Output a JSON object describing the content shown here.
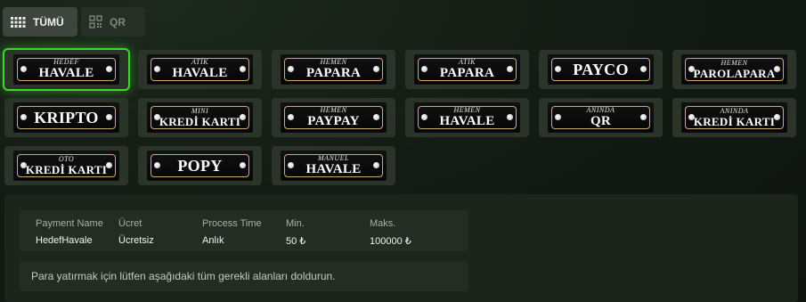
{
  "tabs": [
    {
      "label": "TÜMÜ",
      "icon": "grid-icon",
      "active": true
    },
    {
      "label": "QR",
      "icon": "qr-code-icon",
      "active": false
    }
  ],
  "methods": [
    {
      "prefix": "HEDEF",
      "name": "HAVALE",
      "active": true
    },
    {
      "prefix": "ATİK",
      "name": "HAVALE"
    },
    {
      "prefix": "HEMEN",
      "name": "PAPARA"
    },
    {
      "prefix": "ATİK",
      "name": "PAPARA"
    },
    {
      "prefix": "",
      "name": "PAYCO"
    },
    {
      "prefix": "HEMEN",
      "name": "PAROLAPARA"
    },
    {
      "prefix": "",
      "name": "KRIPTO"
    },
    {
      "prefix": "MINI",
      "name": "KREDİ KARTI"
    },
    {
      "prefix": "HEMEN",
      "name": "PAYPAY"
    },
    {
      "prefix": "HEMEN",
      "name": "HAVALE"
    },
    {
      "prefix": "ANINDA",
      "name": "QR"
    },
    {
      "prefix": "ANINDA",
      "name": "KREDİ KARTI"
    },
    {
      "prefix": "OTO",
      "name": "KREDİ KARTI"
    },
    {
      "prefix": "",
      "name": "POPY"
    },
    {
      "prefix": "MANUEL",
      "name": "HAVALE"
    }
  ],
  "details": {
    "columns": [
      {
        "header": "Payment Name",
        "value": "HedefHavale"
      },
      {
        "header": "Ücret",
        "value": "Ücretsiz"
      },
      {
        "header": "Process Time",
        "value": "Anlık"
      },
      {
        "header": "Min.",
        "value": "50 ₺"
      },
      {
        "header": "Maks.",
        "value": "100000 ₺"
      }
    ],
    "note": "Para yatırmak için lütfen aşağıdaki tüm gerekli alanları doldurun."
  },
  "colors": {
    "active_glow": "#3fd62f",
    "badge_border": "#c9ad6e",
    "background": "#141b14"
  }
}
